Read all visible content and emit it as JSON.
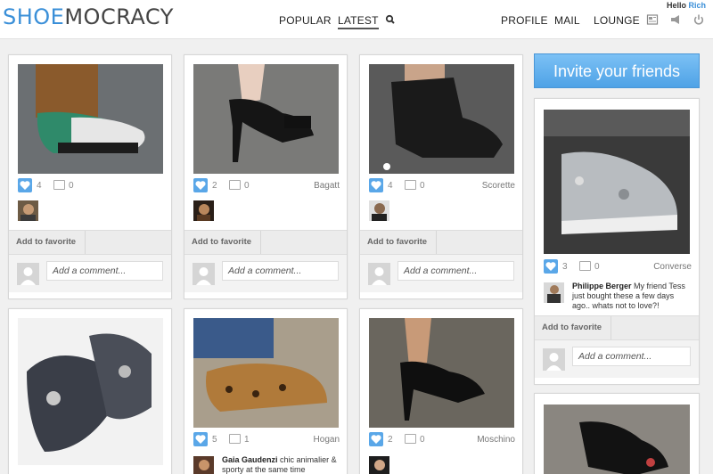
{
  "header": {
    "logo_part1": "SHOE",
    "logo_part2": "MOCRACY",
    "nav_popular": "POPULAR",
    "nav_latest": "LATEST",
    "nav_profile": "PROFILE",
    "nav_mail": "MAIL",
    "nav_lounge": "LOUNGE",
    "hello_text": "Hello",
    "hello_user": "Rich",
    "icons": [
      "search-icon",
      "newspaper-icon",
      "megaphone-icon",
      "power-icon"
    ]
  },
  "sidebar": {
    "invite_label": "Invite your friends"
  },
  "common": {
    "add_favorite": "Add to favorite",
    "comment_placeholder": "Add a comment..."
  },
  "cards": [
    {
      "likes": "4",
      "comments": "0",
      "brand": ""
    },
    {
      "likes": "2",
      "comments": "0",
      "brand": "Bagatt"
    },
    {
      "likes": "4",
      "comments": "0",
      "brand": "Scorette"
    },
    {
      "likes": "3",
      "comments": "0",
      "brand": "Converse",
      "caption_user": "Philippe Berger",
      "caption_text": "My friend Tess just bought these a few days ago.. whats not to love?!"
    },
    {
      "likes": "5",
      "comments": "1",
      "brand": "Hogan",
      "caption_user": "Gaia Gaudenzi",
      "caption_text": "chic animalier & sporty at the same time"
    },
    {
      "likes": "2",
      "comments": "0",
      "brand": "Moschino"
    }
  ],
  "colors": {
    "accent": "#3a8fd8",
    "heart": "#5aa7e8",
    "invite_bg": "#5aaeee"
  }
}
